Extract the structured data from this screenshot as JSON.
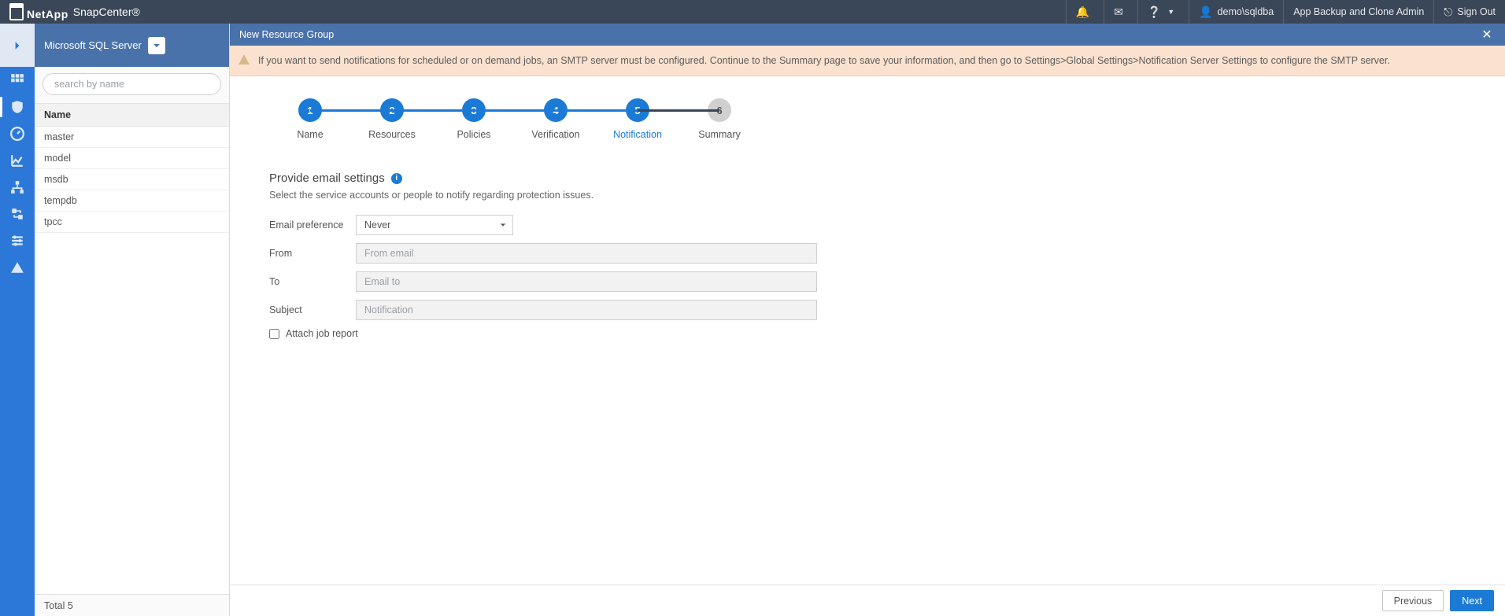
{
  "brand": {
    "company": "NetApp",
    "product": "SnapCenter®"
  },
  "topbar": {
    "user": "demo\\sqldba",
    "role": "App Backup and Clone Admin",
    "signout": "Sign Out"
  },
  "sidebar": {
    "view_label": "Microsoft SQL Server",
    "search_placeholder": "search by name",
    "column_header": "Name",
    "items": [
      "master",
      "model",
      "msdb",
      "tempdb",
      "tpcc"
    ],
    "total_label": "Total 5"
  },
  "content": {
    "title": "New Resource Group",
    "warning": "If you want to send notifications for scheduled or on demand jobs, an SMTP server must be configured. Continue to the Summary page to save your information, and then go to Settings>Global Settings>Notification Server Settings to configure the SMTP server."
  },
  "wizard": {
    "steps": [
      {
        "num": "1",
        "label": "Name"
      },
      {
        "num": "2",
        "label": "Resources"
      },
      {
        "num": "3",
        "label": "Policies"
      },
      {
        "num": "4",
        "label": "Verification"
      },
      {
        "num": "5",
        "label": "Notification"
      },
      {
        "num": "6",
        "label": "Summary"
      }
    ],
    "active_index": 4
  },
  "form": {
    "title": "Provide email settings",
    "subtitle": "Select the service accounts or people to notify regarding protection issues.",
    "email_pref_label": "Email preference",
    "email_pref_value": "Never",
    "from_label": "From",
    "from_placeholder": "From email",
    "to_label": "To",
    "to_placeholder": "Email to",
    "subject_label": "Subject",
    "subject_placeholder": "Notification",
    "attach_label": "Attach job report"
  },
  "footer": {
    "previous": "Previous",
    "next": "Next"
  }
}
